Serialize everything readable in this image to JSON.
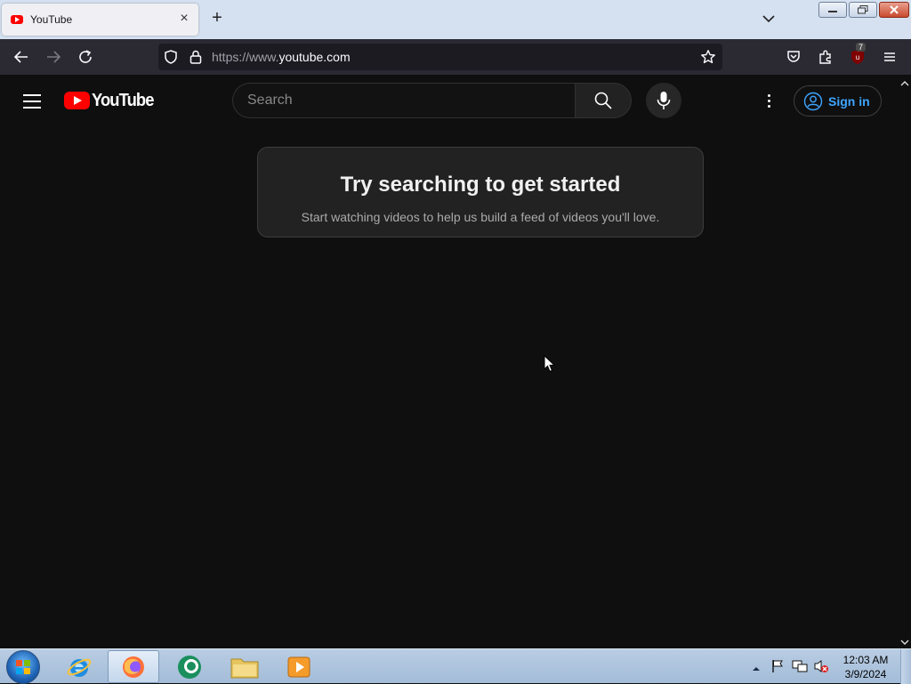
{
  "browser": {
    "tab": {
      "title": "YouTube",
      "favicon": "youtube-favicon-icon"
    },
    "url": {
      "prefix": "https://www.",
      "domain": "youtube.com"
    },
    "extension_badge": "7"
  },
  "youtube": {
    "logo_text": "YouTube",
    "search": {
      "placeholder": "Search"
    },
    "signin_label": "Sign in",
    "empty_feed": {
      "title": "Try searching to get started",
      "subtitle": "Start watching videos to help us build a feed of videos you'll love."
    }
  },
  "taskbar": {
    "apps": [
      "start-orb-icon",
      "internet-explorer-icon",
      "firefox-icon",
      "app-icon",
      "file-explorer-icon",
      "media-player-icon"
    ],
    "clock": {
      "time": "12:03 AM",
      "date": "3/9/2024"
    }
  },
  "colors": {
    "brand_red": "#ff0000",
    "link_blue": "#3ea6ff",
    "background": "#0f0f0f"
  }
}
